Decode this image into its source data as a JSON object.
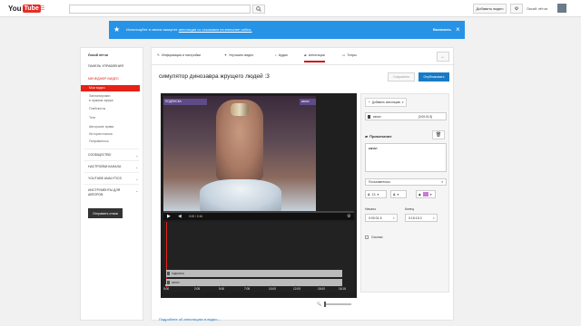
{
  "header": {
    "logo_you": "You",
    "logo_tube": "Tube",
    "upload_label": "Добавить видео",
    "username": "Лисий лётчи"
  },
  "notice": {
    "message": "Используйте в своем аккаунте",
    "link": "аннотации со ссылками на внешние сайты.",
    "enable": "Включить"
  },
  "sidebar": {
    "channel": "Лисий лётчи",
    "dashboard": "ПАНЕЛЬ УПРАВЛЕНИЯ",
    "video_manager": "МЕНЕДЖЕР ВИДЕО",
    "items": [
      "Мои видео",
      "Запланирован",
      "в прямом эфире",
      "Плейлисты",
      "Теги",
      "Авторские права",
      "История поиска",
      "Понравилось"
    ],
    "sections": [
      "СООБЩЕСТВО",
      "НАСТРОЙКИ КАНАЛА",
      "YOUTUBE ANALYTICS",
      "ИНСТРУМЕНТЫ ДЛЯ",
      "АВТОРОВ"
    ],
    "send_feedback": "Отправить отзыв"
  },
  "tabs": [
    "Информация и настройки",
    "Улучшить видео",
    "Аудио",
    "Аннотации",
    "Титры"
  ],
  "video": {
    "title": "симулятор динозавра жрущего людей :3",
    "save": "Сохранено",
    "publish": "Опубликовать",
    "time_display": "0:00 / 0:16",
    "annotation_label_1": "ПОДПИСКА",
    "annotation_label_2": "канал"
  },
  "timeline": {
    "tracks": [
      "подписка",
      "канал"
    ],
    "ticks": [
      "0:00",
      "2:05",
      "5:00",
      "7:05",
      "10:00",
      "12:05",
      "15:00",
      "16:16"
    ]
  },
  "panel": {
    "add_annotation": "Добавить аннотацию",
    "entry_name": "канал",
    "entry_time": "[0:00:01.5]",
    "type": "Примечание",
    "text_value": "канал",
    "style": "Пользовательск.",
    "font_size": "13",
    "start_label": "Начало",
    "end_label": "Конец",
    "start_value": "0:00:01.5",
    "end_value": "0:15:15.3",
    "link_label": "Ссылка"
  },
  "footer_link": "Подробнее об аннотациях в видео..."
}
